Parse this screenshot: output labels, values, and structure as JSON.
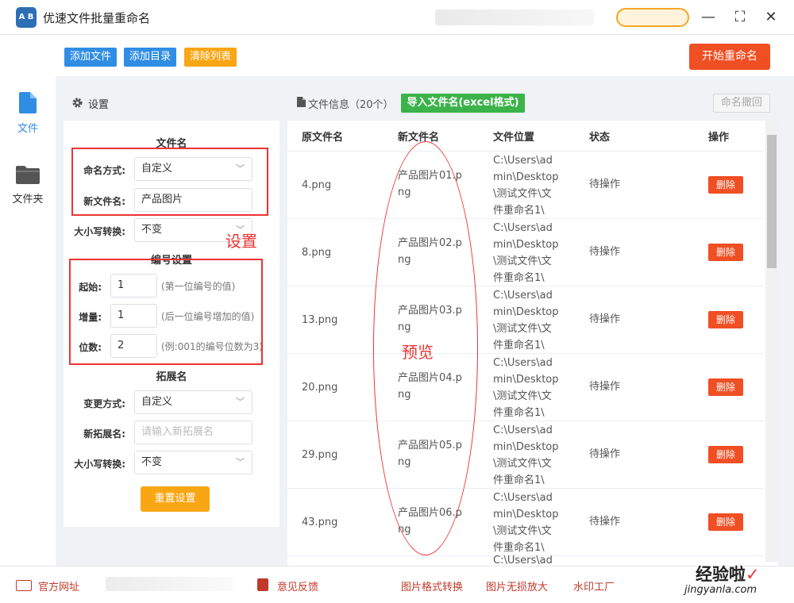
{
  "app": {
    "title": "优速文件批量重命名",
    "logo_text": "A B",
    "window_controls": [
      "—",
      "⛶",
      "✕"
    ]
  },
  "nav": [
    {
      "label": "文件",
      "icon": "file-icon",
      "active": true
    },
    {
      "label": "文件夹",
      "icon": "folder-icon",
      "active": false
    }
  ],
  "toolbar": {
    "add_file": "添加文件",
    "add_dir": "添加目录",
    "clear_list": "清除列表",
    "start_rename": "开始重命名"
  },
  "settings": {
    "title": "设置",
    "filename_section": "文件名",
    "naming_mode_label": "命名方式:",
    "naming_mode_value": "自定义",
    "new_name_label": "新文件名:",
    "new_name_value": "产品图片",
    "case_label": "大小写转换:",
    "case_value": "不变",
    "numbering_section": "编号设置",
    "start_label": "起始:",
    "start_value": "1",
    "start_hint": "(第一位编号的值)",
    "increment_label": "增量:",
    "increment_value": "1",
    "increment_hint": "(后一位编号增加的值)",
    "digits_label": "位数:",
    "digits_value": "2",
    "digits_hint": "(例:001的编号位数为3)",
    "ext_section": "拓展名",
    "ext_mode_label": "变更方式:",
    "ext_mode_value": "自定义",
    "new_ext_label": "新拓展名:",
    "new_ext_placeholder": "请输入新拓展名",
    "ext_case_label": "大小写转换:",
    "ext_case_value": "不变",
    "reset_button": "重置设置"
  },
  "files": {
    "info_label": "文件信息（20个）",
    "import_button": "导入文件名(excel格式)",
    "undo_button": "命名撤回",
    "columns": [
      "原文件名",
      "新文件名",
      "文件位置",
      "状态",
      "操作"
    ],
    "rows": [
      {
        "orig": "4.png",
        "new1": "产品图片01.p",
        "new2": "ng",
        "loc": [
          "C:\\Users\\ad",
          "min\\Desktop",
          "\\测试文件\\文",
          "件重命名1\\"
        ],
        "status": "待操作",
        "action": "删除"
      },
      {
        "orig": "8.png",
        "new1": "产品图片02.p",
        "new2": "ng",
        "loc": [
          "C:\\Users\\ad",
          "min\\Desktop",
          "\\测试文件\\文",
          "件重命名1\\"
        ],
        "status": "待操作",
        "action": "删除"
      },
      {
        "orig": "13.png",
        "new1": "产品图片03.p",
        "new2": "ng",
        "loc": [
          "C:\\Users\\ad",
          "min\\Desktop",
          "\\测试文件\\文",
          "件重命名1\\"
        ],
        "status": "待操作",
        "action": "删除"
      },
      {
        "orig": "20.png",
        "new1": "产品图片04.p",
        "new2": "ng",
        "loc": [
          "C:\\Users\\ad",
          "min\\Desktop",
          "\\测试文件\\文",
          "件重命名1\\"
        ],
        "status": "待操作",
        "action": "删除"
      },
      {
        "orig": "29.png",
        "new1": "产品图片05.p",
        "new2": "ng",
        "loc": [
          "C:\\Users\\ad",
          "min\\Desktop",
          "\\测试文件\\文",
          "件重命名1\\"
        ],
        "status": "待操作",
        "action": "删除"
      },
      {
        "orig": "43.png",
        "new1": "产品图片06.p",
        "new2": "ng",
        "loc": [
          "C:\\Users\\ad",
          "min\\Desktop",
          "\\测试文件\\文",
          "件重命名1\\"
        ],
        "status": "待操作",
        "action": "删除"
      }
    ],
    "partial_row_loc": "C:\\Users\\ad"
  },
  "annotations": {
    "settings_note": "设置",
    "preview_note": "预览"
  },
  "footer": {
    "website": "官方网址",
    "feedback": "意见反馈",
    "format_convert": "图片格式转换",
    "lossless_zoom": "图片无损放大",
    "watermark": "水印工厂",
    "watermark_brand": "经验啦",
    "watermark_url": "jingyanla.com"
  },
  "colors": {
    "blue_btn": "#2f8de4",
    "orange_btn": "#f9a614",
    "start_btn": "#f04e23",
    "import_btn": "#3bb34a",
    "annotation": "#e33333"
  }
}
